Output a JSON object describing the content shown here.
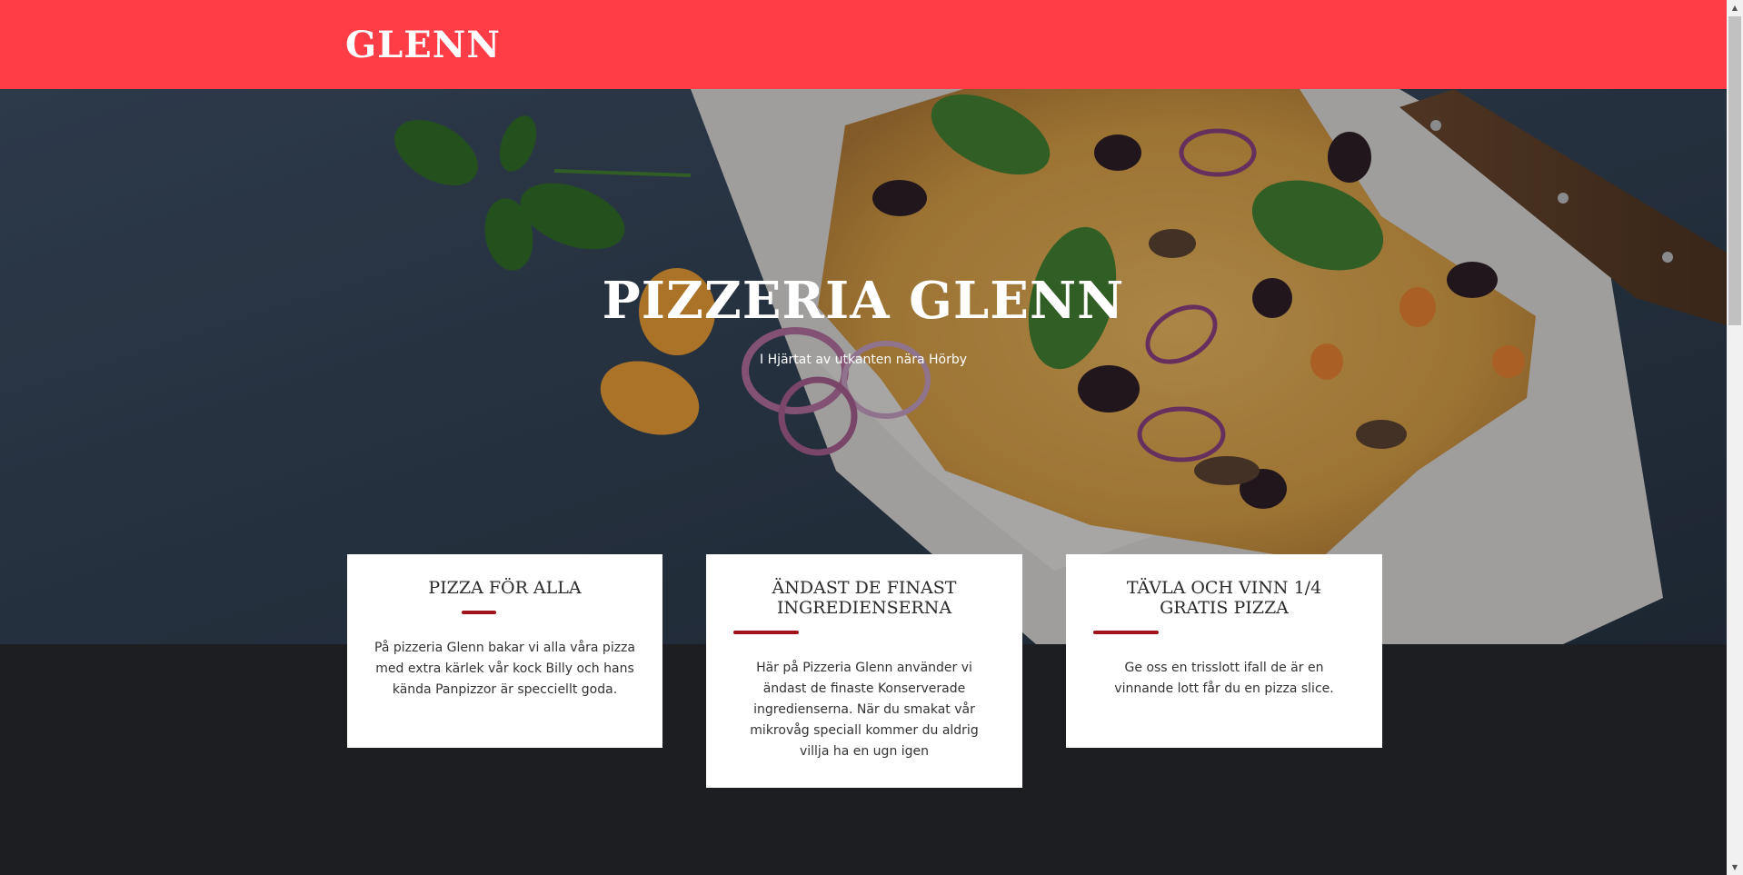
{
  "header": {
    "brand": "GLENN",
    "background_color": "#ff3d47"
  },
  "hero": {
    "title": "PIZZERIA GLENN",
    "subtitle": "I Hjärtat av utkanten nära Hörby"
  },
  "cards": [
    {
      "title": "PIZZA FÖR ALLA",
      "text": "På pizzeria Glenn bakar vi alla våra pizza med extra kärlek vår kock Billy och hans kända Panpizzor är specciellt goda."
    },
    {
      "title": "ÄNDAST DE FINAST INGREDIENSERNA",
      "text": "Här på Pizzeria Glenn använder vi ändast de finaste Konserverade ingredienserna. När du smakat vår mikrovåg speciall kommer du aldrig villja ha en ugn igen"
    },
    {
      "title": "TÄVLA OCH VINN 1/4 GRATIS PIZZA",
      "text": "Ge oss en trisslott ifall de är en vinnande lott får du en pizza slice."
    }
  ],
  "colors": {
    "accent_rule": "#a0131b",
    "page_background": "#1d1e22"
  }
}
